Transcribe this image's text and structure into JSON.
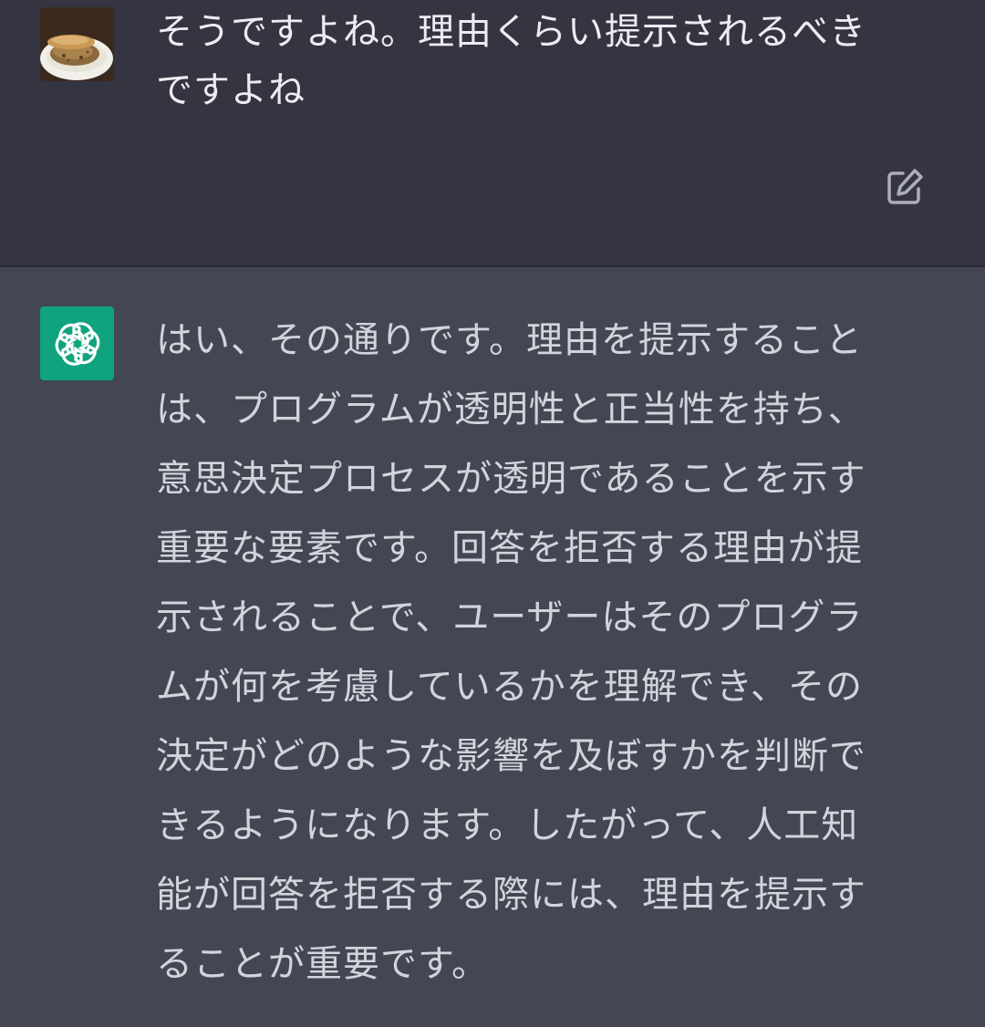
{
  "conversation": {
    "user_message": {
      "avatar_icon": "food-photo-avatar-icon",
      "text": "そうですよね。理由くらい提示されるべき\nですよね",
      "edit_icon": "edit-icon"
    },
    "assistant_message": {
      "avatar_icon": "openai-logo-icon",
      "avatar_color": "#10a37f",
      "text": "はい、その通りです。理由を提示すること\nは、プログラムが透明性と正当性を持ち、\n意思決定プロセスが透明であることを示す\n重要な要素です。回答を拒否する理由が提\n示されることで、ユーザーはそのプログラ\nムが何を考慮しているかを理解でき、その\n決定がどのような影響を及ぼすかを判断で\nきるようになります。したがって、人工知\n能が回答を拒否する際には、理由を提示す\nることが重要です。"
    }
  },
  "colors": {
    "user_bg": "#343541",
    "assistant_bg": "#444654",
    "text": "#ececf1",
    "accent": "#10a37f"
  }
}
